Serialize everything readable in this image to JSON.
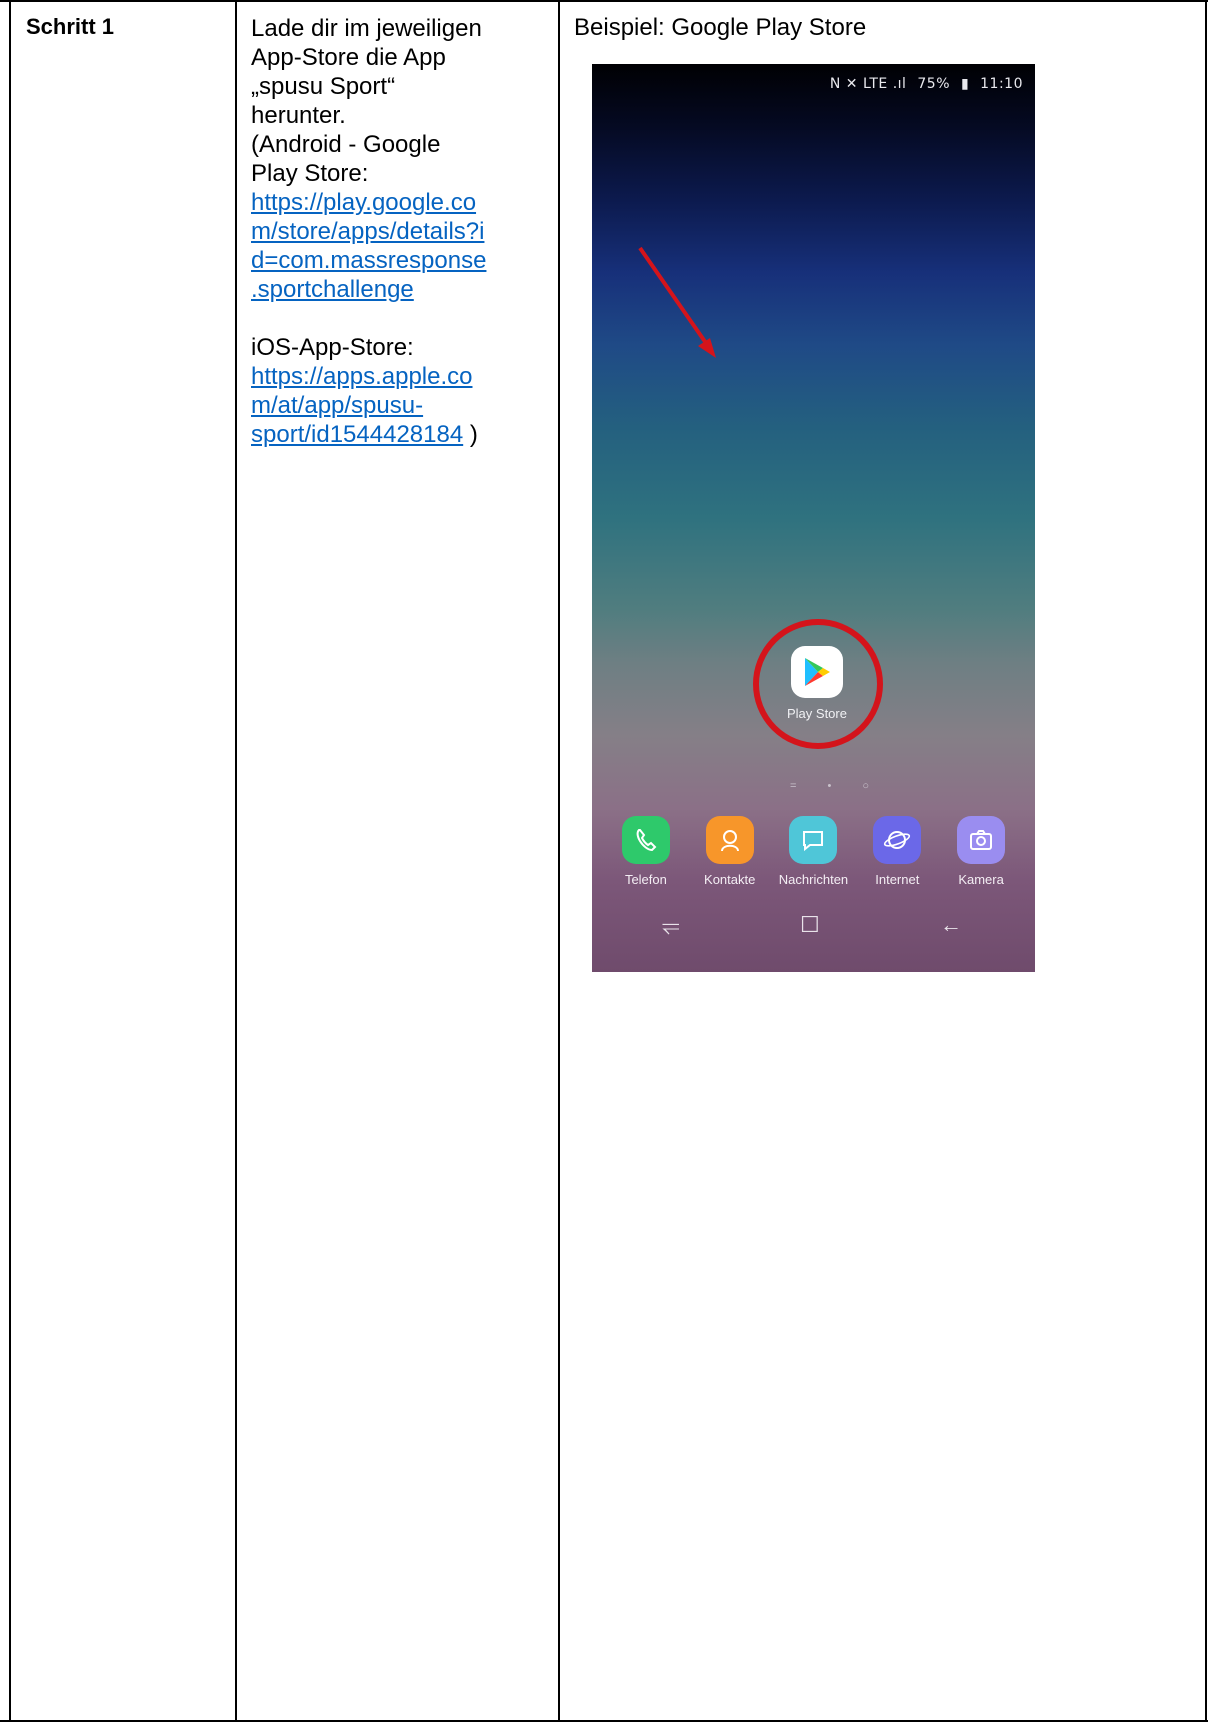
{
  "table": {
    "step_label": "Schritt 1",
    "instructions": {
      "line1": "Lade dir im jeweiligen",
      "line2": "App-Store die App",
      "line3": "„spusu Sport“",
      "line4": "herunter.",
      "line5": "(Android - Google",
      "line6": "Play Store:",
      "android_link_lines": [
        "https://play.google.co",
        "m/store/apps/details?i",
        "d=com.massresponse",
        ".sportchallenge"
      ],
      "ios_label": "iOS-App-Store:",
      "ios_link_lines": [
        "https://apps.apple.co",
        "m/at/app/spusu-",
        "sport/id1544428184"
      ],
      "closing_paren": " )"
    },
    "example_title": "Beispiel: Google Play Store"
  },
  "phone": {
    "status_bar": {
      "icons": "N ✕ LTE .ıl",
      "battery": "75%",
      "time": "11:10"
    },
    "highlighted_app": {
      "label": "Play Store",
      "icon": "play-store-icon"
    },
    "page_indicator": "= • ○",
    "dock": [
      {
        "label": "Telefon",
        "icon": "phone-icon",
        "color": "#2ec96b"
      },
      {
        "label": "Kontakte",
        "icon": "contacts-icon",
        "color": "#f7962a"
      },
      {
        "label": "Nachrichten",
        "icon": "message-icon",
        "color": "#4fc6d8"
      },
      {
        "label": "Internet",
        "icon": "globe-icon",
        "color": "#6b68e8"
      },
      {
        "label": "Kamera",
        "icon": "camera-icon",
        "color": "#9a8df0"
      }
    ],
    "navigation": {
      "recent": "⥫",
      "home": "☐",
      "back": "←"
    },
    "colors": {
      "highlight_ring": "#d4141b",
      "arrow": "#d4141b"
    }
  }
}
